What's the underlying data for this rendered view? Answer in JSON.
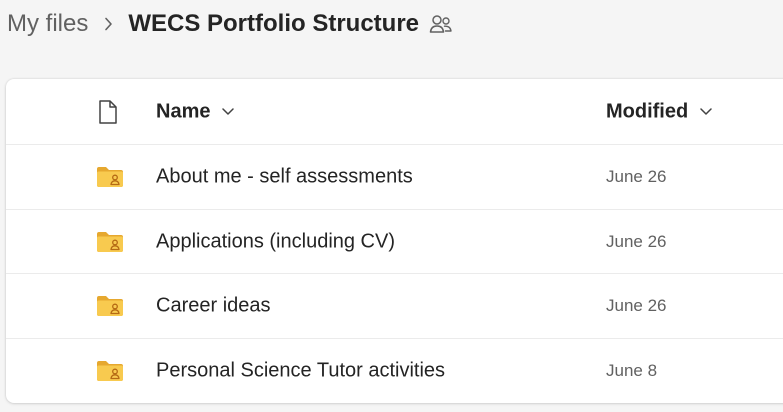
{
  "breadcrumb": {
    "root": "My files",
    "current": "WECS Portfolio Structure"
  },
  "table": {
    "columns": {
      "name": "Name",
      "modified": "Modified"
    },
    "rows": [
      {
        "name": "About me - self assessments",
        "modified": "June 26"
      },
      {
        "name": "Applications (including CV)",
        "modified": "June 26"
      },
      {
        "name": "Career ideas",
        "modified": "June 26"
      },
      {
        "name": "Personal Science Tutor activities",
        "modified": "June 8"
      }
    ]
  },
  "icons": {
    "separator": "chevron-right-icon",
    "shared": "people-shared-icon",
    "file_type_header": "document-icon",
    "sort": "chevron-down-icon",
    "row": "shared-folder-icon"
  },
  "colors": {
    "folder_body": "#F8CA4F",
    "folder_tab": "#E6A82F",
    "background": "#f5f5f5"
  }
}
